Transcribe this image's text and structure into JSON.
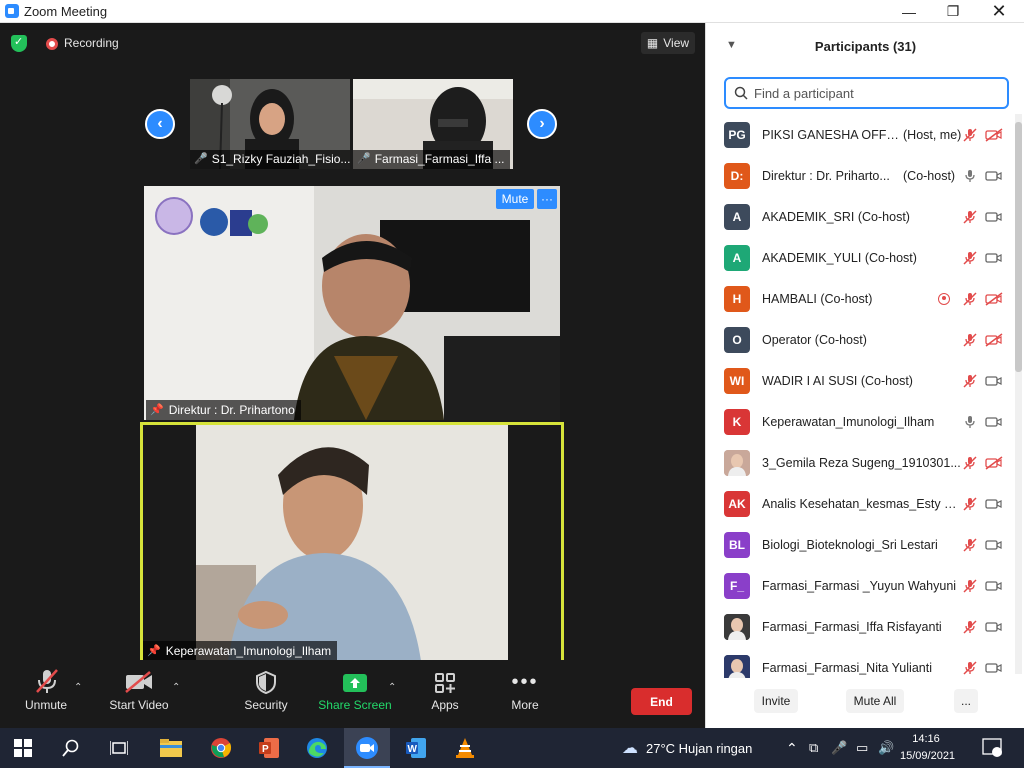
{
  "window": {
    "title": "Zoom Meeting"
  },
  "meeting": {
    "recording_label": "Recording",
    "view_label": "View",
    "gallery": [
      {
        "name": "S1_Rizky Fauziah_Fisio..."
      },
      {
        "name": "Farmasi_Farmasi_Iffa ..."
      }
    ],
    "speaker": {
      "name": "Direktur : Dr. Prihartono",
      "mute_label": "Mute",
      "more_label": "···"
    },
    "active": {
      "name": "Keperawatan_Imunologi_Ilham"
    }
  },
  "toolbar": {
    "unmute": "Unmute",
    "start_video": "Start Video",
    "security": "Security",
    "share_screen": "Share Screen",
    "apps": "Apps",
    "more": "More",
    "end": "End"
  },
  "participants": {
    "title": "Participants (31)",
    "search_placeholder": "Find a participant",
    "items": [
      {
        "initials": "PG",
        "color": "#3d4a5c",
        "name": "PIKSI GANESHA OFFI...",
        "role": "(Host, me)",
        "mic": "muted",
        "video": "off"
      },
      {
        "initials": "D:",
        "color": "#e0581a",
        "name": "Direktur : Dr. Priharto...",
        "role": "(Co-host)",
        "mic": "on",
        "video": "on"
      },
      {
        "initials": "A",
        "color": "#3d4a5c",
        "name": "AKADEMIK_SRI (Co-host)",
        "role": "",
        "mic": "muted",
        "video": "on"
      },
      {
        "initials": "A",
        "color": "#1ea876",
        "name": "AKADEMIK_YULI (Co-host)",
        "role": "",
        "mic": "muted",
        "video": "on"
      },
      {
        "initials": "H",
        "color": "#e0581a",
        "name": "HAMBALI (Co-host)",
        "role": "",
        "mic": "muted",
        "video": "off",
        "recording": true
      },
      {
        "initials": "O",
        "color": "#3d4a5c",
        "name": "Operator (Co-host)",
        "role": "",
        "mic": "muted",
        "video": "off"
      },
      {
        "initials": "WI",
        "color": "#e0581a",
        "name": "WADIR I AI SUSI (Co-host)",
        "role": "",
        "mic": "muted",
        "video": "on"
      },
      {
        "initials": "K",
        "color": "#d93636",
        "name": "Keperawatan_Imunologi_Ilham",
        "role": "",
        "mic": "on",
        "video": "on"
      },
      {
        "initials": "",
        "color": "#c9a89a",
        "name": "3_Gemila Reza Sugeng_1910301...",
        "role": "",
        "mic": "muted",
        "video": "off",
        "photo": true
      },
      {
        "initials": "AK",
        "color": "#d93636",
        "name": "Analis Kesehatan_kesmas_Esty B...",
        "role": "",
        "mic": "muted",
        "video": "on"
      },
      {
        "initials": "BL",
        "color": "#8a3fc9",
        "name": "Biologi_Bioteknologi_Sri Lestari",
        "role": "",
        "mic": "muted",
        "video": "on"
      },
      {
        "initials": "F_",
        "color": "#8a3fc9",
        "name": "Farmasi_Farmasi _Yuyun Wahyuni",
        "role": "",
        "mic": "muted",
        "video": "on"
      },
      {
        "initials": "",
        "color": "#3a3a3a",
        "name": "Farmasi_Farmasi_Iffa Risfayanti",
        "role": "",
        "mic": "muted",
        "video": "on",
        "photo": true
      },
      {
        "initials": "",
        "color": "#2c3a6a",
        "name": "Farmasi_Farmasi_Nita Yulianti",
        "role": "",
        "mic": "muted",
        "video": "on",
        "photo": true
      }
    ],
    "invite": "Invite",
    "mute_all": "Mute All",
    "more": "..."
  },
  "taskbar": {
    "weather": "27°C  Hujan ringan",
    "time": "14:16",
    "date": "15/09/2021",
    "notifications": "1"
  }
}
